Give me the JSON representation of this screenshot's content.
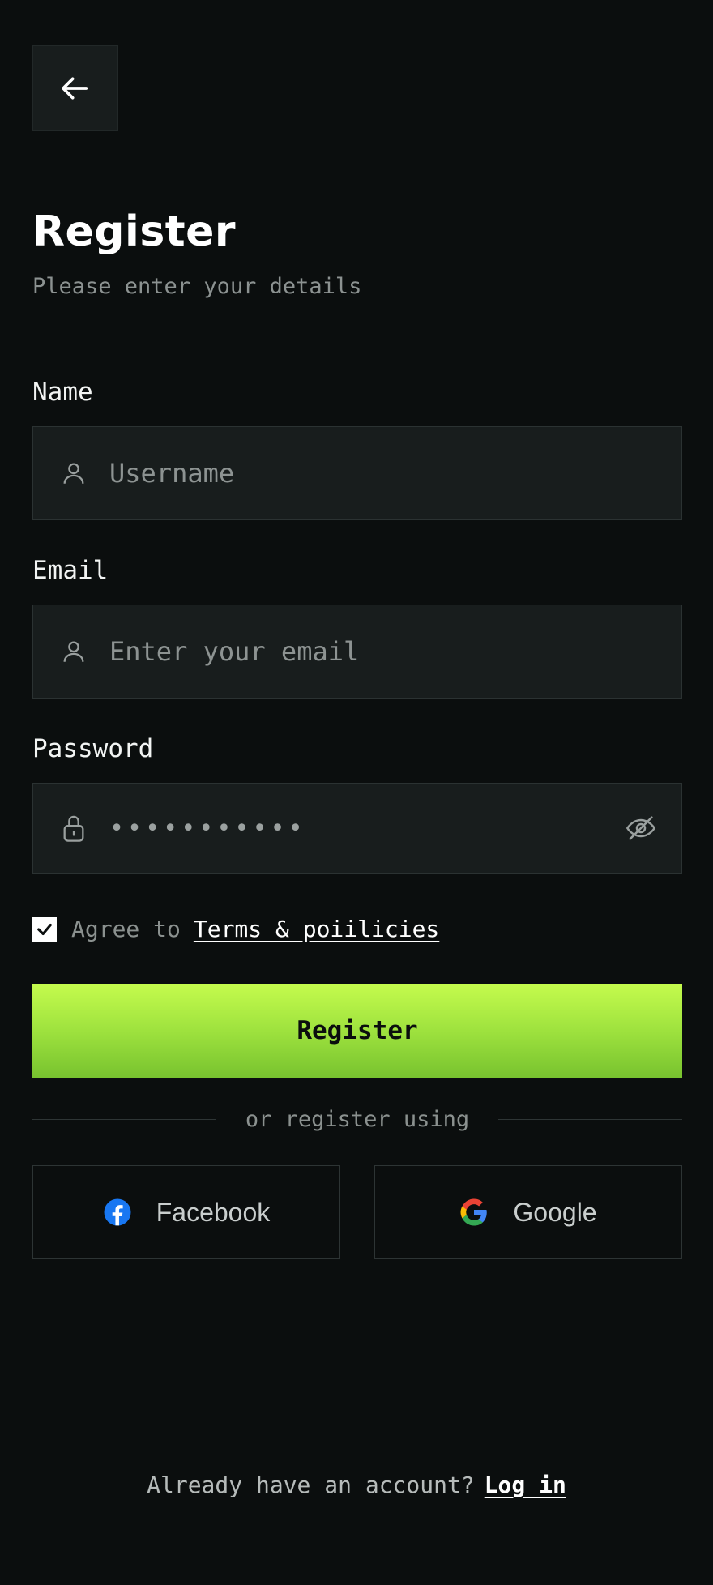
{
  "header": {
    "back_icon": "arrow-left-icon",
    "title": "Register",
    "subtitle": "Please enter your details"
  },
  "form": {
    "name": {
      "label": "Name",
      "placeholder": "Username",
      "value": "",
      "icon": "user-icon"
    },
    "email": {
      "label": "Email",
      "placeholder": "Enter your email",
      "value": "",
      "icon": "user-icon"
    },
    "password": {
      "label": "Password",
      "masked_value": "•••••••••••",
      "icon": "lock-icon",
      "toggle_icon": "eye-off-icon"
    },
    "agree": {
      "checked": true,
      "text": "Agree to",
      "link_label": "Terms & poiilicies"
    },
    "submit_label": "Register"
  },
  "social": {
    "divider_text": "or register using",
    "facebook_label": "Facebook",
    "google_label": "Google"
  },
  "footer": {
    "prompt": "Already have an account?",
    "link_label": "Log in"
  },
  "colors": {
    "background": "#0b0e0e",
    "field_bg": "#181d1d",
    "accent_top": "#c5fb4d",
    "accent_bottom": "#78c32f",
    "facebook": "#1877f2"
  }
}
